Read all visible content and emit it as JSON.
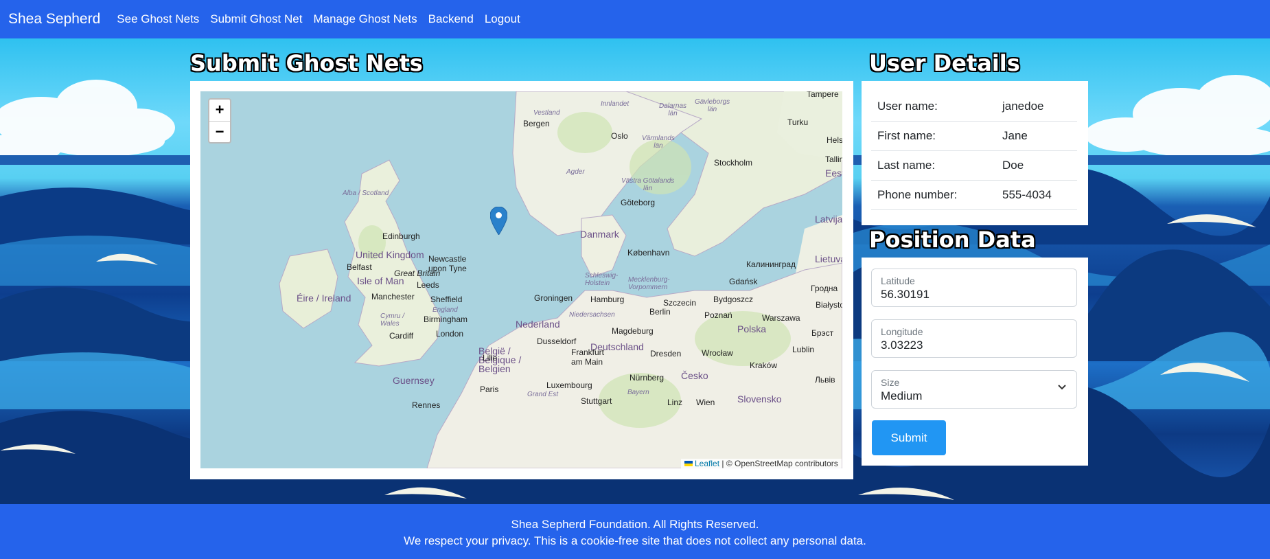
{
  "nav": {
    "brand": "Shea Sepherd",
    "links": [
      "See Ghost Nets",
      "Submit Ghost Net",
      "Manage Ghost Nets",
      "Backend",
      "Logout"
    ]
  },
  "submit_section": {
    "title": "Submit Ghost Nets",
    "zoom_in": "+",
    "zoom_out": "−",
    "attribution_leaflet": "Leaflet",
    "attribution_rest": "| © OpenStreetMap contributors",
    "map_labels": {
      "bergen": "Bergen",
      "oslo": "Oslo",
      "stockholm": "Stockholm",
      "turku": "Turku",
      "tampere": "Tampere",
      "goteborg": "Göteborg",
      "danmark": "Danmark",
      "kobenhavn": "København",
      "edinburgh": "Edinburgh",
      "uk": "United Kingdom",
      "newcastle": "Newcastle\nupon Tyne",
      "great_britain": "Great Britain",
      "belfast": "Belfast",
      "isle_of_man": "Isle of Man",
      "eire": "Éire / Ireland",
      "manchester": "Manchester",
      "leeds": "Leeds",
      "sheffield": "Sheffield",
      "birmingham": "Birmingham",
      "england": "England",
      "cardiff": "Cardiff",
      "london": "London",
      "cymru": "Cymru /\nWales",
      "guernsey": "Guernsey",
      "groningen": "Groningen",
      "nederland": "Nederland",
      "hamburg": "Hamburg",
      "dusseldorf": "Dusseldorf",
      "deutschland": "Deutschland",
      "berlin": "Berlin",
      "magdeburg": "Magdeburg",
      "frankfurt": "Frankfurt\nam Main",
      "dresden": "Dresden",
      "polska": "Polska",
      "warszawa": "Warszawa",
      "poznan": "Poznań",
      "szczecin": "Szczecin",
      "bydgoszcz": "Bydgoszcz",
      "gdansk": "Gdańsk",
      "kaliningrad": "Калининград",
      "wroclaw": "Wrocław",
      "belgie": "België /\nBelgique /\nBelgien",
      "lille": "Lille",
      "luxembourg": "Luxembourg",
      "paris": "Paris",
      "nurnberg": "Nürnberg",
      "stuttgart": "Stuttgart",
      "cesko": "Česko",
      "krakow": "Kraków",
      "lublin": "Lublin",
      "rennes": "Rennes",
      "linz": "Linz",
      "wien": "Wien",
      "slovensko": "Slovensko",
      "latvija": "Latvija",
      "lietuva": "Lietuva",
      "helsinki": "Hels",
      "tallinn": "Tallin",
      "eesti": "Eest",
      "grodno": "Гродна",
      "bialystok": "Białystok",
      "brest": "Брэст",
      "lviv": "Львів",
      "alba": "Alba / Scotland",
      "vestland": "Vestland",
      "innlandet": "Innlandet",
      "dalarnas": "Dalarnas\nlän",
      "gavleborgs": "Gävleborgs\nlän",
      "varmlands": "Värmlands\nlän",
      "agder": "Agder",
      "vastra": "Västra Götalands\nlän",
      "schleswig": "Schleswig-\nHolstein",
      "mecklenburg": "Mecklenburg-\nVorpommern",
      "niedersachsen": "Niedersachsen",
      "bayern": "Bayern",
      "grand_est": "Grand Est"
    }
  },
  "user_details": {
    "title": "User Details",
    "rows": [
      {
        "label": "User name:",
        "value": "janedoe"
      },
      {
        "label": "First name:",
        "value": "Jane"
      },
      {
        "label": "Last name:",
        "value": "Doe"
      },
      {
        "label": "Phone number:",
        "value": "555-4034"
      }
    ]
  },
  "position_data": {
    "title": "Position Data",
    "latitude_label": "Latitude",
    "latitude_value": "56.30191",
    "longitude_label": "Longitude",
    "longitude_value": "3.03223",
    "size_label": "Size",
    "size_value": "Medium",
    "submit_label": "Submit"
  },
  "footer": {
    "line1": "Shea Sepherd Foundation. All Rights Reserved.",
    "line2": "We respect your privacy. This is a cookie-free site that does not collect any personal data."
  },
  "colors": {
    "navbar": "#2563eb",
    "submit_button": "#2196f3",
    "marker": "#2a81cb"
  }
}
